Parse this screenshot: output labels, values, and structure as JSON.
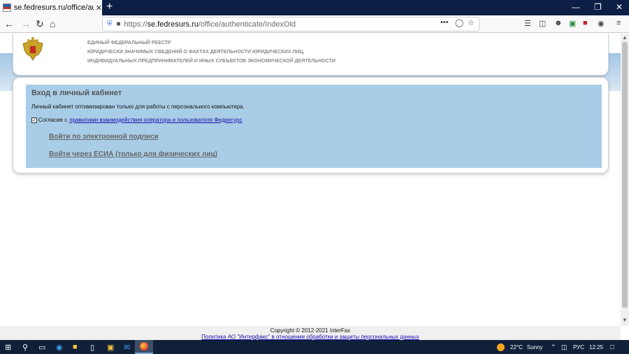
{
  "browser": {
    "tab_title": "se.fedresurs.ru/office/authentica",
    "tab_close": "✕",
    "new_tab": "+",
    "url_domain": "se.fedresurs.ru",
    "url_prefix": "https://",
    "url_path": "/office/authenticate/IndexOld",
    "window_controls": [
      "—",
      "❐",
      "✕"
    ]
  },
  "header": {
    "registry_lines": [
      "ЕДИНЫЙ ФЕДЕРАЛЬНЫЙ РЕЕСТР",
      "ЮРИДИЧЕСКИ ЗНАЧИМЫХ СВЕДЕНИЙ О ФАКТАХ ДЕЯТЕЛЬНОСТИ ЮРИДИЧЕСКИХ ЛИЦ,",
      "ИНДИВИДУАЛЬНЫХ ПРЕДПРИНИМАТЕЛЕЙ И ИНЫХ СУБЪЕКТОВ ЭКОНОМИЧЕСКОЙ ДЕЯТЕЛЬНОСТИ"
    ]
  },
  "login": {
    "title": "Вход в личный кабинет",
    "note": "Личный кабинет оптимизирован только для работы с персонального компьютера.",
    "consent_checked": true,
    "consent_prefix": "Согласие с",
    "consent_link": "правилами взаимодействия оператора и пользователя Федресурс",
    "link_signature": "Войти по электронной подписи",
    "link_esia": "Войти через ЕСИА (только для физических лиц)"
  },
  "footer": {
    "copyright": "Copyright © 2012-2021 InterFax",
    "policy": "Политика АО \"Интерфакс\" в отношении обработки и защиты персональных данных"
  },
  "taskbar": {
    "weather_temp": "22°C",
    "weather_desc": "Sunny",
    "language": "РУС",
    "time": "12:25"
  }
}
